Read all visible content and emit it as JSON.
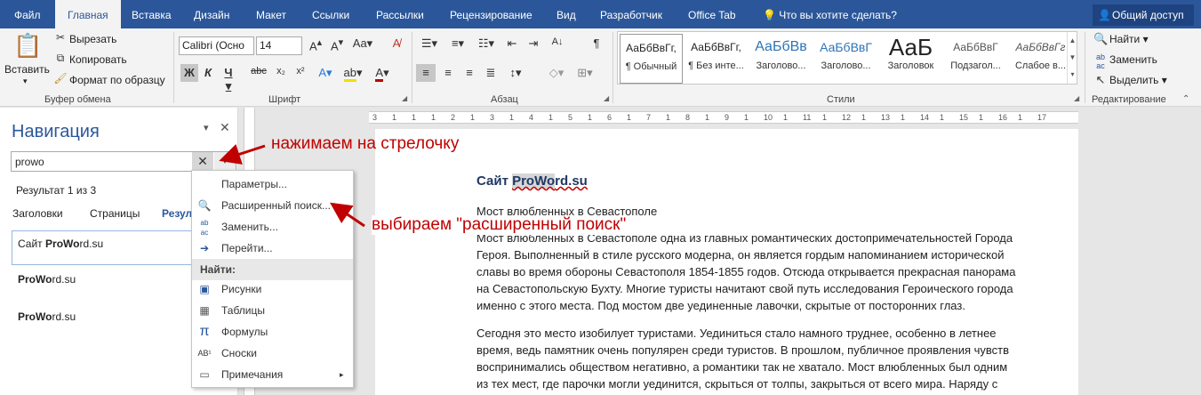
{
  "menubar": {
    "tabs": [
      "Файл",
      "Главная",
      "Вставка",
      "Дизайн",
      "Макет",
      "Ссылки",
      "Рассылки",
      "Рецензирование",
      "Вид",
      "Разработчик",
      "Office Tab"
    ],
    "tell_me": "Что вы хотите сделать?",
    "share": "Общий доступ"
  },
  "ribbon": {
    "clipboard": {
      "paste": "Вставить",
      "cut": "Вырезать",
      "copy": "Копировать",
      "format_painter": "Формат по образцу",
      "label": "Буфер обмена"
    },
    "font": {
      "name": "Calibri (Осно",
      "size": "14",
      "label": "Шрифт"
    },
    "paragraph": {
      "label": "Абзац"
    },
    "styles": {
      "label": "Стили",
      "items": [
        {
          "preview": "АаБбВвГг,",
          "name": "¶ Обычный"
        },
        {
          "preview": "АаБбВвГг,",
          "name": "¶ Без инте..."
        },
        {
          "preview": "АаБбВв",
          "name": "Заголово..."
        },
        {
          "preview": "АаБбВвГ",
          "name": "Заголово..."
        },
        {
          "preview": "АаБ",
          "name": "Заголовок"
        },
        {
          "preview": "АаБбВвГ",
          "name": "Подзагол..."
        },
        {
          "preview": "АаБбВвГг",
          "name": "Слабое в..."
        }
      ]
    },
    "editing": {
      "find": "Найти",
      "replace": "Заменить",
      "select": "Выделить",
      "label": "Редактирование"
    }
  },
  "nav": {
    "title": "Навигация",
    "search_value": "prowo",
    "result": "Результат 1 из 3",
    "tabs": [
      "Заголовки",
      "Страницы",
      "Резул"
    ],
    "results": [
      {
        "pre": "Сайт ",
        "bold": "ProWo",
        "post": "rd.su"
      },
      {
        "pre": "",
        "bold": "ProWo",
        "post": "rd.su"
      },
      {
        "pre": "",
        "bold": "ProWo",
        "post": "rd.su"
      }
    ]
  },
  "dropdown": {
    "params": "Параметры...",
    "advanced": "Расширенный поиск...",
    "replace": "Заменить...",
    "goto": "Перейти...",
    "find_header": "Найти:",
    "pictures": "Рисунки",
    "tables": "Таблицы",
    "formulas": "Формулы",
    "footnotes": "Сноски",
    "comments": "Примечания"
  },
  "annotations": {
    "arrow1": "нажимаем на стрелочку",
    "arrow2": "выбираем \"расширенный поиск\""
  },
  "ruler_labels": [
    "3",
    "1",
    "1",
    "1",
    "2",
    "1",
    "3",
    "1",
    "4",
    "1",
    "5",
    "1",
    "6",
    "1",
    "7",
    "1",
    "8",
    "1",
    "9",
    "1",
    "10",
    "1",
    "11",
    "1",
    "12",
    "1",
    "13",
    "1",
    "14",
    "1",
    "15",
    "1",
    "16",
    "1",
    "17"
  ],
  "document": {
    "title_pre": "Сайт ",
    "title_hl": "ProWo",
    "title_post": "rd.su",
    "heading": "Мост влюбленных в Севастополе",
    "lines": [
      "Мост влюбленных в Севастополе одна из главных романтических достопримечательностей Города",
      "Героя. Выполненный в стиле русского модерна, он является гордым напоминанием исторической",
      "славы во время обороны Севастополя 1854-1855 годов. Отсюда открывается прекрасная панорама",
      "на Севастопольскую Бухту. Многие туристы начитают свой путь исследования Героического города",
      "именно с этого места. Под мостом две уединенные лавочки, скрытые от посторонних глаз.",
      "Сегодня это место изобилует туристами. Уединиться стало намного труднее, особенно в летнее",
      "время, ведь памятник очень популярен среди туристов. В прошлом, публичное проявления чувств",
      "воспринимались обществом негативно, а романтики так не хватало. Мост влюбленных был одним",
      "из тех мест, где парочки могли уединится, скрыться от толпы, закрыться от всего мира. Наряду с"
    ]
  },
  "colors": {
    "accent": "#2b579a",
    "annotation": "#c00000",
    "highlight": "#d6d6d6"
  }
}
